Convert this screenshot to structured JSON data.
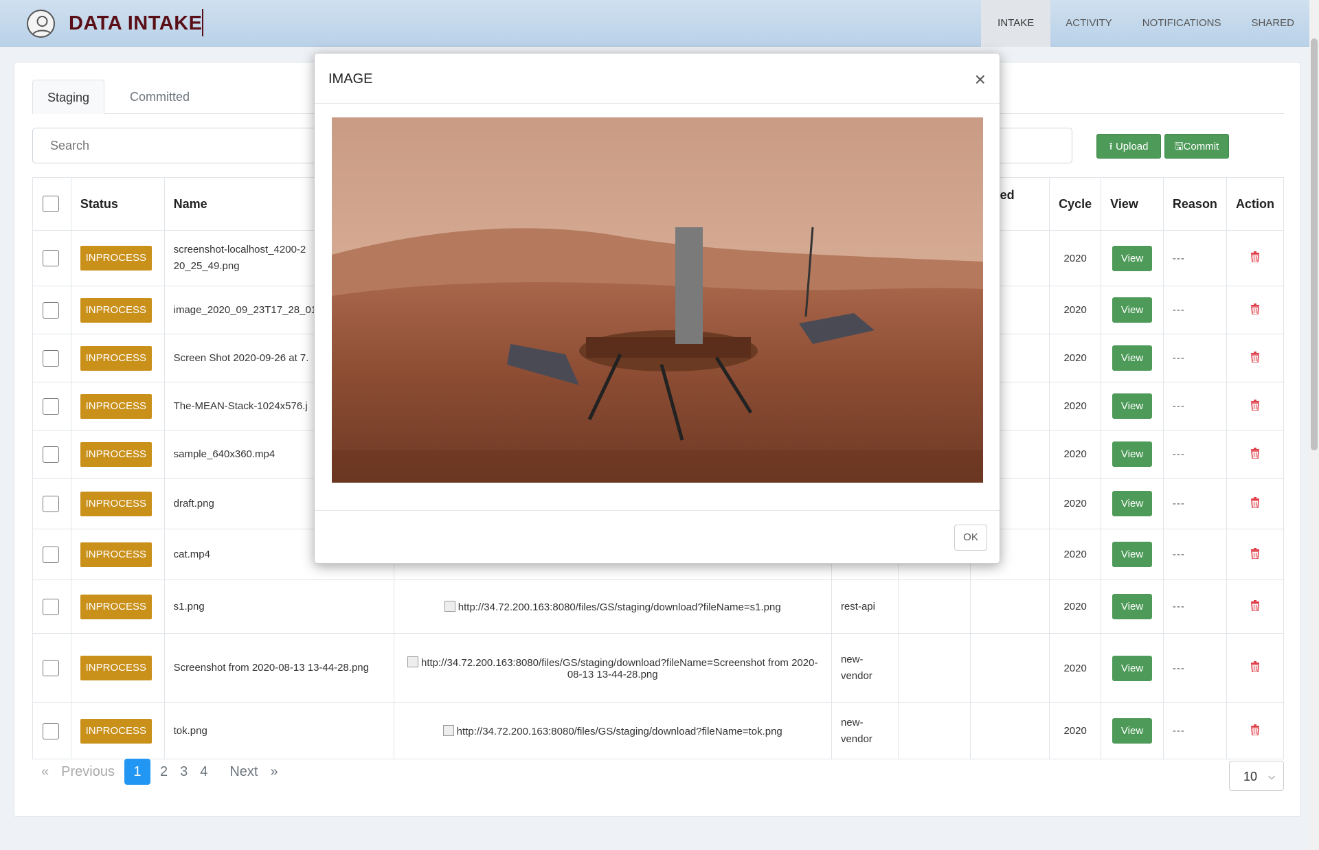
{
  "header": {
    "app_title": "DATA INTAKE",
    "nav": [
      "INTAKE",
      "ACTIVITY",
      "NOTIFICATIONS",
      "SHARED"
    ]
  },
  "tabs": {
    "staging": "Staging",
    "committed": "Committed"
  },
  "search": {
    "placeholder": "Search"
  },
  "toolbar": {
    "upload_label": "Upload",
    "commit_label": "Commit"
  },
  "table": {
    "headers": {
      "status": "Status",
      "name": "Name",
      "modified_date_partial": "lodified\nate",
      "cycle": "Cycle",
      "view": "View",
      "reason": "Reason",
      "action": "Action"
    },
    "rows": [
      {
        "status": "INPROCESS",
        "name": "screenshot-localhost_4200-2\n20_25_49.png",
        "preview": "",
        "vendor": "",
        "cycle": "2020",
        "view": "View",
        "reason": "---"
      },
      {
        "status": "INPROCESS",
        "name": "image_2020_09_23T17_28_01",
        "preview": "",
        "vendor": "",
        "cycle": "2020",
        "view": "View",
        "reason": "---"
      },
      {
        "status": "INPROCESS",
        "name": "Screen Shot 2020-09-26 at 7.",
        "preview": "",
        "vendor": "",
        "cycle": "2020",
        "view": "View",
        "reason": "---"
      },
      {
        "status": "INPROCESS",
        "name": "The-MEAN-Stack-1024x576.j",
        "preview": "",
        "vendor": "",
        "cycle": "2020",
        "view": "View",
        "reason": "---"
      },
      {
        "status": "INPROCESS",
        "name": "sample_640x360.mp4",
        "preview": "",
        "vendor": "",
        "cycle": "2020",
        "view": "View",
        "reason": "---"
      },
      {
        "status": "INPROCESS",
        "name": "draft.png",
        "preview": "",
        "vendor": "",
        "cycle": "2020",
        "view": "View",
        "reason": "---"
      },
      {
        "status": "INPROCESS",
        "name": "cat.mp4",
        "preview": "",
        "vendor": "",
        "cycle": "2020",
        "view": "View",
        "reason": "---"
      },
      {
        "status": "INPROCESS",
        "name": "s1.png",
        "preview": "http://34.72.200.163:8080/files/GS/staging/download?fileName=s1.png",
        "vendor": "rest-api",
        "cycle": "2020",
        "view": "View",
        "reason": "---"
      },
      {
        "status": "INPROCESS",
        "name": "Screenshot from 2020-08-13 13-44-28.png",
        "preview": "http://34.72.200.163:8080/files/GS/staging/download?fileName=Screenshot from 2020-08-13 13-44-28.png",
        "vendor": "new-\nvendor",
        "cycle": "2020",
        "view": "View",
        "reason": "---"
      },
      {
        "status": "INPROCESS",
        "name": "tok.png",
        "preview": "http://34.72.200.163:8080/files/GS/staging/download?fileName=tok.png",
        "vendor": "new-\nvendor",
        "cycle": "2020",
        "view": "View",
        "reason": "---"
      }
    ]
  },
  "pagination": {
    "previous": "Previous",
    "next": "Next",
    "first_arrow": "«",
    "last_arrow": "»",
    "pages": [
      "1",
      "2",
      "3",
      "4"
    ],
    "current": "1",
    "per_page": "10"
  },
  "modal": {
    "title": "IMAGE",
    "close": "×",
    "ok_label": "OK"
  },
  "colors": {
    "badge": "#c9901a",
    "green_button": "#4e9a59",
    "brand_title": "#5a0f17",
    "pager_active": "#2196f3",
    "trash": "#e0414b"
  }
}
